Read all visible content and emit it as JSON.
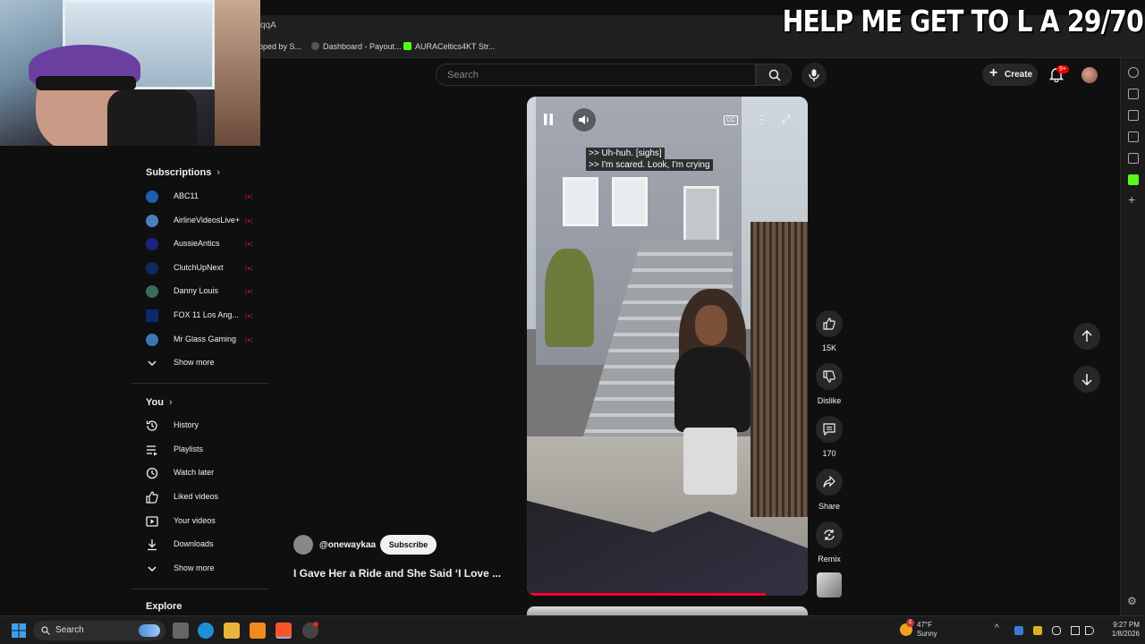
{
  "browser": {
    "address_text": "qqA",
    "bookmarks": [
      {
        "label": "pped by S...",
        "color": ""
      },
      {
        "label": "Dashboard - Payout...",
        "color": "#888888"
      },
      {
        "label": "AURACeltics4KT Str...",
        "color": "#53fc18"
      }
    ]
  },
  "stream_overlay": {
    "title": "HELP ME GET TO L A 29/70"
  },
  "header": {
    "search_placeholder": "Search",
    "create_label": "Create",
    "notification_count": "9+"
  },
  "sidebar": {
    "subscriptions_title": "Subscriptions",
    "subscriptions": [
      {
        "label": "ABC11",
        "color": "#1b5fb0"
      },
      {
        "label": "AirlineVideosLive+",
        "color": "#4a7fc0"
      },
      {
        "label": "AussieAntics",
        "color": "#1a237e"
      },
      {
        "label": "ClutchUpNext",
        "color": "#102a5c"
      },
      {
        "label": "Danny Louis",
        "color": "#3b6b5a"
      },
      {
        "label": "FOX 11 Los Ang...",
        "color": "#0b2a6b"
      },
      {
        "label": "Mr Glass Gaming",
        "color": "#3a77b5"
      }
    ],
    "show_more_1": "Show more",
    "you_title": "You",
    "you_items": [
      {
        "label": "History",
        "icon": "history-icon"
      },
      {
        "label": "Playlists",
        "icon": "playlists-icon"
      },
      {
        "label": "Watch later",
        "icon": "watch-later-icon"
      },
      {
        "label": "Liked videos",
        "icon": "like-icon"
      },
      {
        "label": "Your videos",
        "icon": "your-videos-icon"
      },
      {
        "label": "Downloads",
        "icon": "download-icon"
      }
    ],
    "show_more_2": "Show more",
    "explore_title": "Explore"
  },
  "short": {
    "captions": [
      ">> Uh-huh. [sighs]",
      ">> I'm scared. Look, I'm crying"
    ],
    "cc_label": "CC",
    "progress": 0.85,
    "channel": "@onewaykaa",
    "subscribe_label": "Subscribe",
    "title": "I Gave Her a Ride and She Said ‘I Love ...",
    "actions": {
      "likes": "15K",
      "dislike": "Dislike",
      "comments": "170",
      "share": "Share",
      "remix": "Remix"
    }
  },
  "taskbar": {
    "search_label": "Search",
    "weather_temp": "47°F",
    "weather_desc": "Sunny",
    "weather_badge": "2",
    "time": "9:27 PM",
    "date": "1/8/2026"
  },
  "colors": {
    "accent_red": "#ff0033",
    "background": "#0f0f0f",
    "kick_green": "#53fc18"
  }
}
